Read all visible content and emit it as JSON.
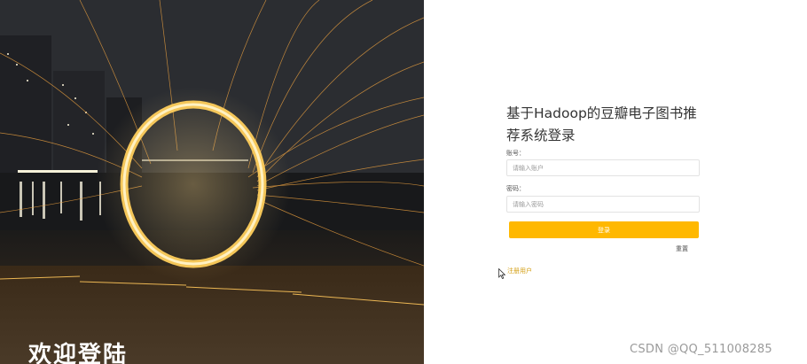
{
  "hero": {
    "title": "欢迎登陆",
    "image": "steel-wool-firework-ring-photo"
  },
  "login": {
    "title": "基于Hadoop的豆瓣电子图书推荐系统登录",
    "account_label": "账号：",
    "account_placeholder": "请输入账户",
    "password_label": "密码：",
    "password_placeholder": "请输入密码",
    "login_button": "登录",
    "reset_link": "重置",
    "register_link": "注册用户"
  },
  "watermark": "CSDN @QQ_511008285",
  "colors": {
    "accent": "#ffb800",
    "link": "#d4a017",
    "text": "#333333"
  },
  "icons": {
    "cursor": "mouse-pointer-icon"
  }
}
